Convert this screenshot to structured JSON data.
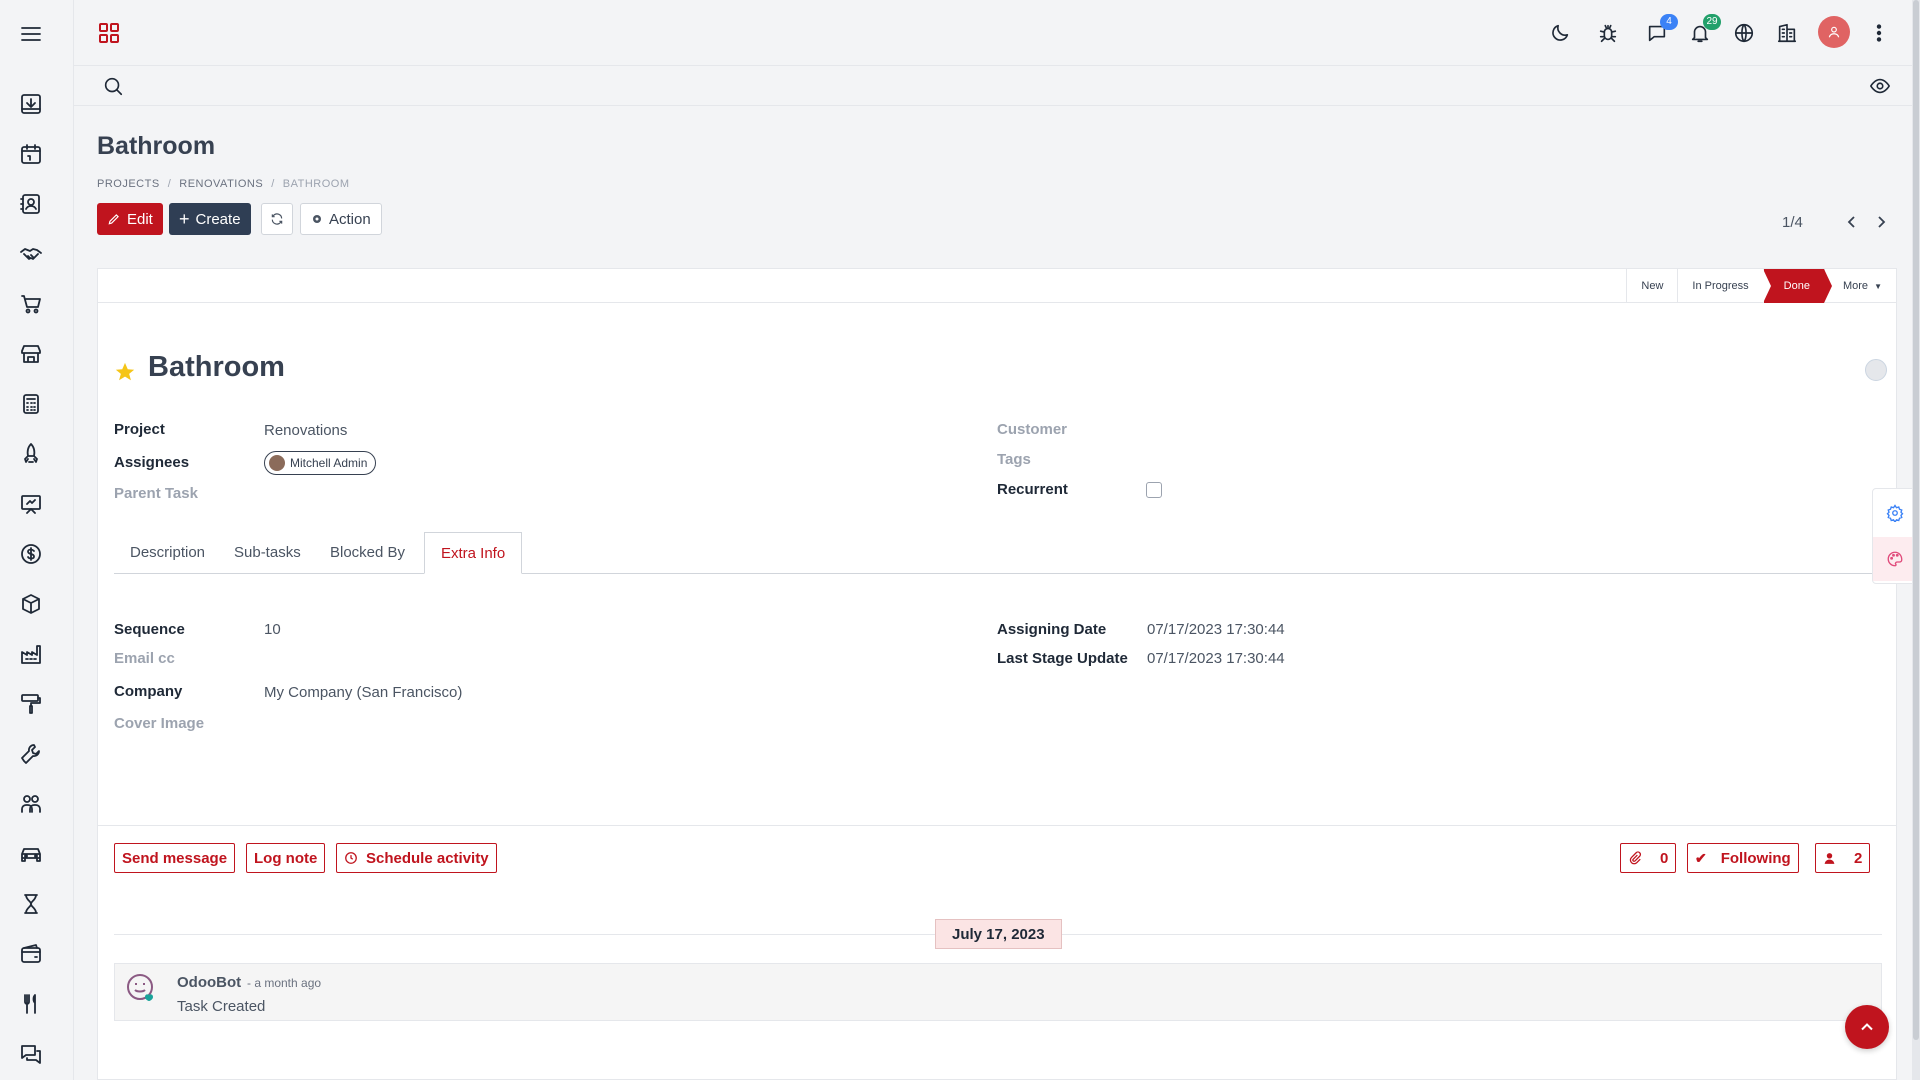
{
  "sidebar": {
    "icons": [
      "menu-icon",
      "download-box-icon",
      "calendar-icon",
      "contacts-icon",
      "handshake-icon",
      "cart-icon",
      "store-icon",
      "calculator-icon",
      "rocket-icon",
      "presentation-icon",
      "dollar-icon",
      "box-icon",
      "factory-icon",
      "paint-roller-icon",
      "wrench-icon",
      "team-icon",
      "car-icon",
      "hourglass-icon",
      "wallet-icon",
      "utensils-icon",
      "chat-icon"
    ]
  },
  "topbar": {
    "messages_count": "4",
    "notifications_count": "29"
  },
  "page": {
    "title": "Bathroom",
    "breadcrumb": [
      "PROJECTS",
      "RENOVATIONS",
      "BATHROOM"
    ],
    "breadcrumb_sep": "/"
  },
  "toolbar": {
    "edit_label": "Edit",
    "create_label": "Create",
    "action_label": "Action"
  },
  "pager": {
    "text": "1/4"
  },
  "stages": {
    "items": [
      "New",
      "In Progress",
      "Done",
      "More"
    ],
    "active": "Done"
  },
  "task": {
    "name": "Bathroom",
    "fields_left": [
      {
        "label": "Project",
        "value": "Renovations"
      },
      {
        "label": "Assignees",
        "value": "Mitchell Admin"
      },
      {
        "label": "Parent Task",
        "value": ""
      }
    ],
    "fields_right": [
      {
        "label": "Customer",
        "value": ""
      },
      {
        "label": "Tags",
        "value": ""
      },
      {
        "label": "Recurrent",
        "value": ""
      }
    ]
  },
  "tabs": [
    "Description",
    "Sub-tasks",
    "Blocked By",
    "Extra Info"
  ],
  "extra_info": {
    "left": [
      {
        "label": "Sequence",
        "value": "10"
      },
      {
        "label": "Email cc",
        "value": ""
      },
      {
        "label": "Company",
        "value": "My Company (San Francisco)"
      },
      {
        "label": "Cover Image",
        "value": ""
      }
    ],
    "right": [
      {
        "label": "Assigning Date",
        "value": "07/17/2023 17:30:44"
      },
      {
        "label": "Last Stage Update",
        "value": "07/17/2023 17:30:44"
      }
    ]
  },
  "chatter": {
    "send_message": "Send message",
    "log_note": "Log note",
    "schedule_activity": "Schedule activity",
    "attachments_count": "0",
    "following_label": "Following",
    "followers_count": "2",
    "date_separator": "July 17, 2023",
    "messages": [
      {
        "author": "OdooBot",
        "date": "- a month ago",
        "body": "Task Created"
      }
    ]
  },
  "colors": {
    "primary": "#c0141e",
    "dark": "#2f3e54",
    "badge_blue": "#3b82f6",
    "badge_green": "#22a06b"
  }
}
